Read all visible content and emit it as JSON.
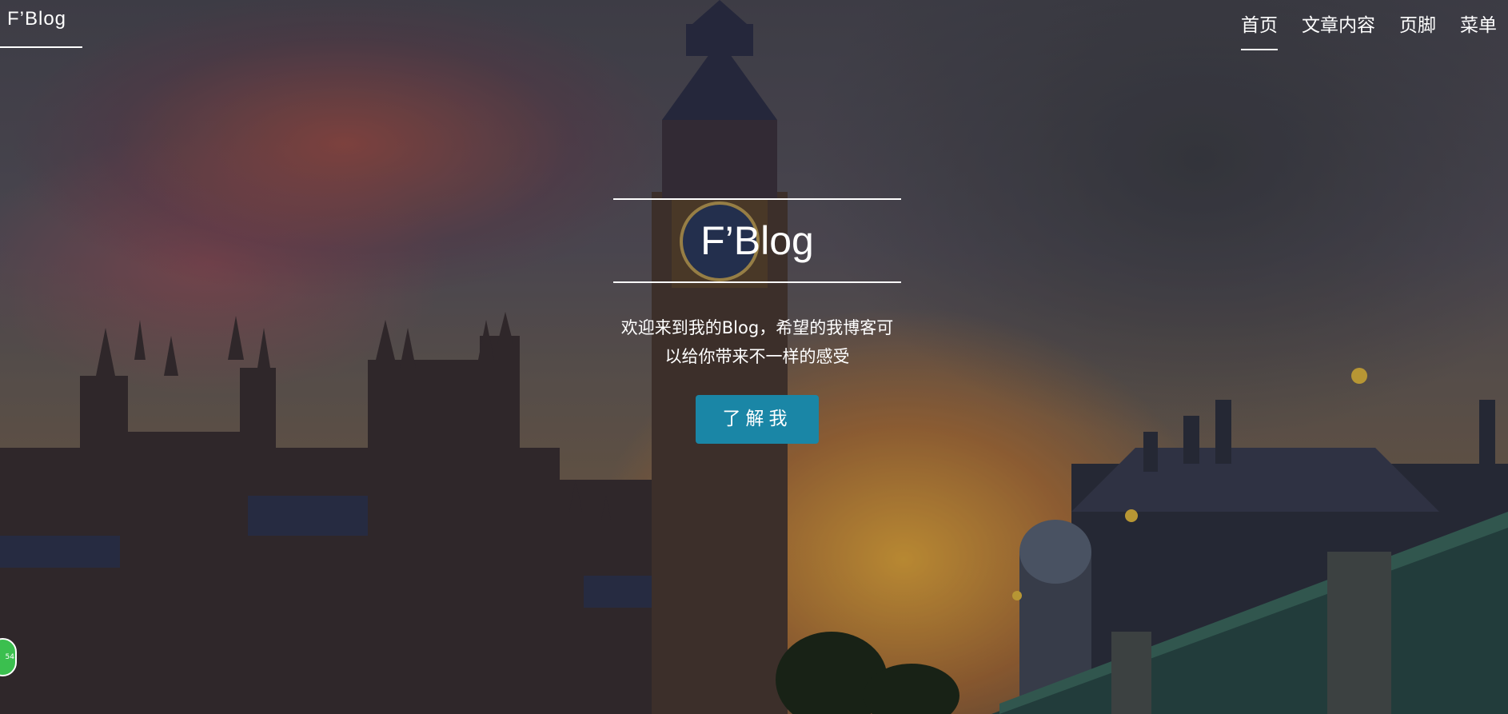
{
  "header": {
    "brand": "F’Blog",
    "nav": [
      {
        "label": "首页",
        "active": true
      },
      {
        "label": "文章内容",
        "active": false
      },
      {
        "label": "页脚",
        "active": false
      },
      {
        "label": "菜单",
        "active": false
      }
    ]
  },
  "hero": {
    "title": "F’Blog",
    "subtitle_line1": "欢迎来到我的Blog，希望的我博客可",
    "subtitle_line2": "以给你带来不一样的感受",
    "button_label": "了解我"
  },
  "badge": {
    "text": "54"
  },
  "colors": {
    "button": "#1a86a6",
    "badge": "#3bbf4f"
  }
}
